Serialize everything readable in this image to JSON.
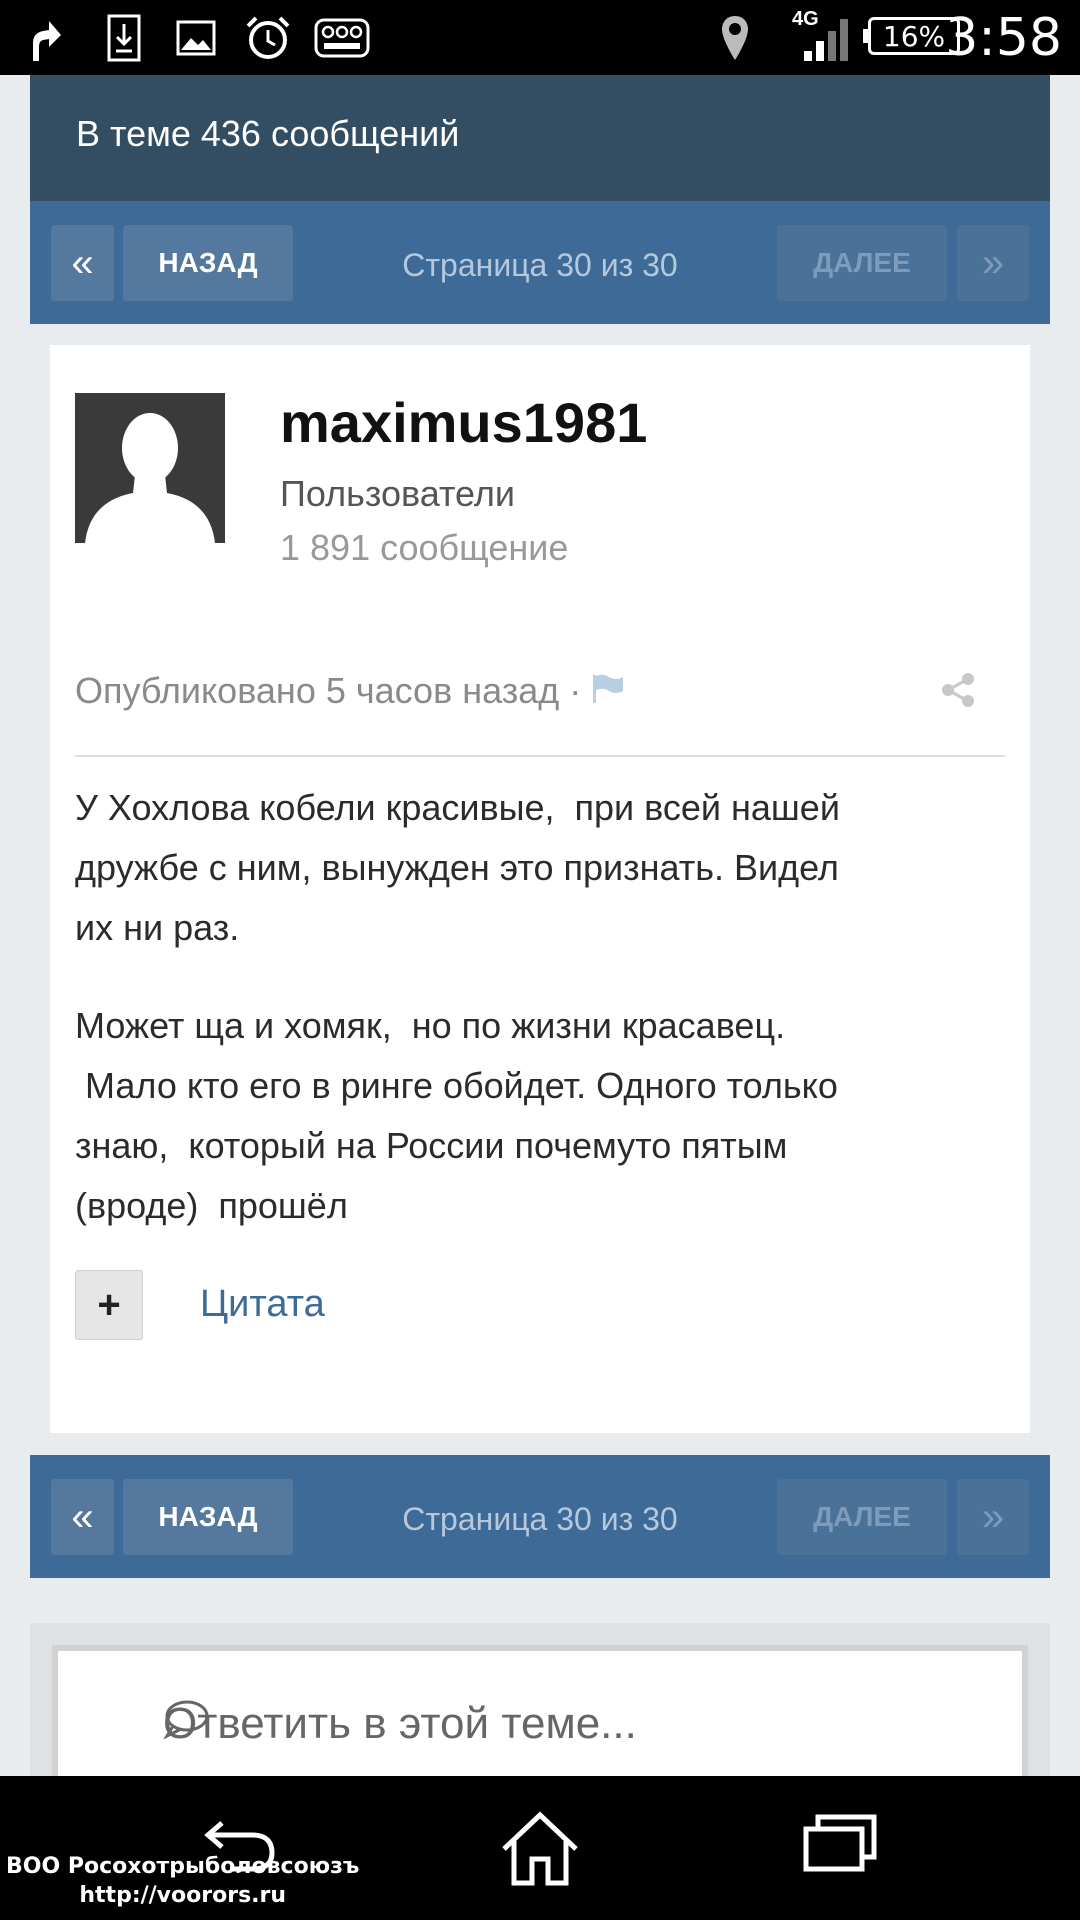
{
  "status_bar": {
    "time": "3:58",
    "battery": "16%",
    "network": "4G",
    "icons": [
      "upload-arrow-icon",
      "download-file-icon",
      "image-icon",
      "alarm-clock-icon",
      "toy-blast-icon",
      "location-pin-icon",
      "signal-icon",
      "battery-icon"
    ]
  },
  "topic": {
    "header": "В теме 436 сообщений"
  },
  "pager": {
    "first": "«",
    "back": "НАЗАД",
    "info": "Страница 30 из 30",
    "next": "ДАЛЕЕ",
    "last": "»"
  },
  "post": {
    "username": "maximus1981",
    "group": "Пользователи",
    "post_count": "1 891 сообщение",
    "published": "Опубликовано 5 часов назад ·",
    "paragraph1": "У Хохлова кобели красивые,  при всей нашей\nдружбе с ним, вынужден это признать. Видел\nих ни раз.",
    "paragraph2": "Может ща и хомяк,  но по жизни красавец.\n Мало кто его в ринге обойдет. Одного только\nзнаю,  который на России почемуто пятым\n(вроде)  прошёл",
    "plus": "+",
    "quote": "Цитата"
  },
  "reply": {
    "placeholder": "Ответить в этой теме..."
  },
  "watermark": {
    "line1": "ВОО Росохотрыболовсоюзъ",
    "line2": "http://voorors.ru"
  },
  "colors": {
    "header": "#334e63",
    "pager": "#3d6a96",
    "link": "#3b6c97"
  }
}
